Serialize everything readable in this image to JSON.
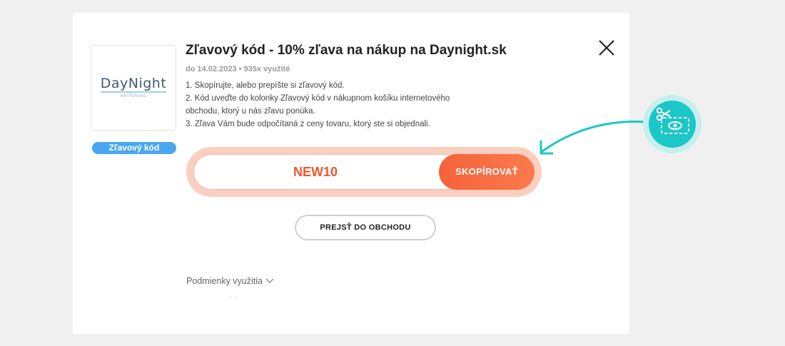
{
  "offer": {
    "title": "Zľavový kód - 10% zľava na nákup na Daynight.sk",
    "meta": "do 14.02.2023 • 935x využité",
    "instructions": [
      "1. Skopírujte, alebo prepíšte si zľavový kód.",
      "2. Kód uveďte do kolonky Zľavový kód v nákupnom košíku internetového",
      "obchodu, ktorý u nás zľavu ponúka.",
      "3. Zľava Vám bude odpočítaná z ceny tovaru, ktorý ste si objednali."
    ]
  },
  "logo": {
    "text": "DayNight",
    "subtext": "WHITENING"
  },
  "badge": {
    "label": "Zľavový kód"
  },
  "code": {
    "value": "NEW10",
    "copy_label": "SKOPÍROVAŤ"
  },
  "shop_button": {
    "label": "PREJSŤ DO OBCHODU"
  },
  "terms": {
    "label": "Podmienky využitia"
  },
  "icons": {
    "close": "close-icon",
    "scissors": "scissors-coupon-icon",
    "arrow": "curved-arrow-icon",
    "chevron": "chevron-down-icon"
  },
  "colors": {
    "accent": "#f5623a",
    "badge": "#4aa7ef",
    "teal": "#1cc7c7",
    "background": "#f0f0f0"
  }
}
